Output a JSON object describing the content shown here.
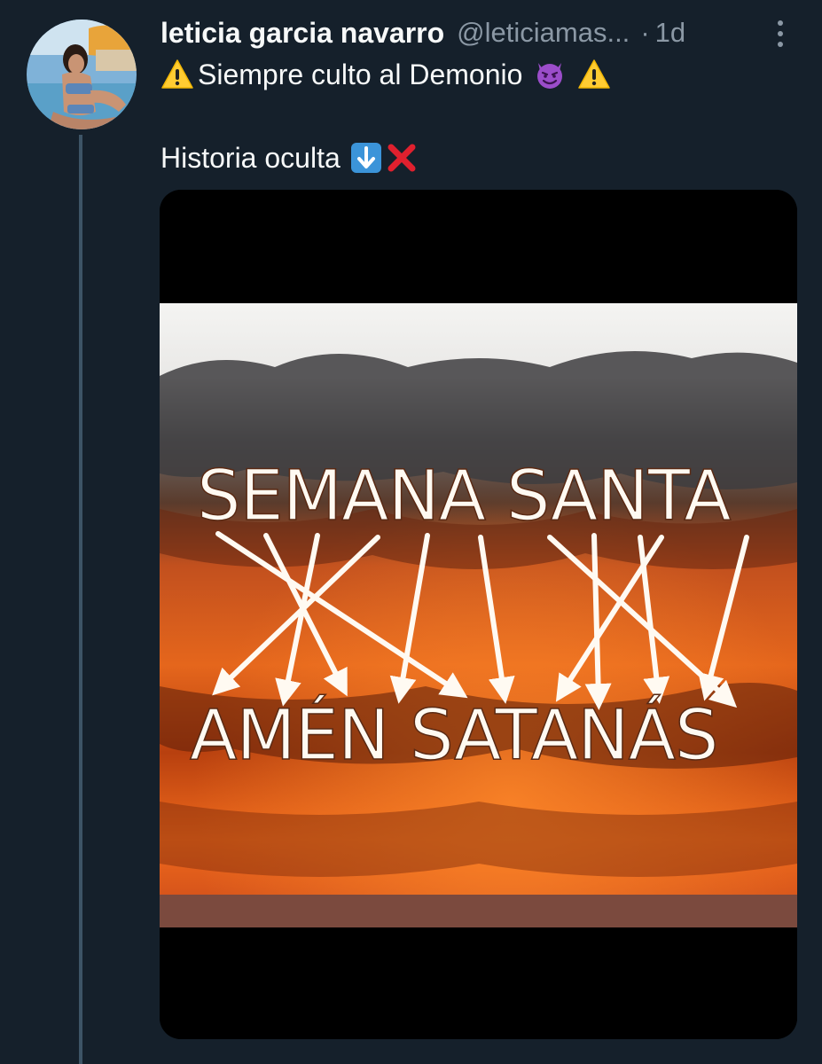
{
  "tweet": {
    "display_name": "leticia garcia navarro",
    "handle": "@leticiamas...",
    "separator": "·",
    "time": "1d",
    "line1": "Siempre culto al Demonio",
    "line2": "Historia oculta"
  },
  "media": {
    "top_text": "SEMANA SANTA",
    "bottom_text": "AMÉN SATANÁS"
  },
  "icons": {
    "warning": "warning-icon",
    "devil": "devil-face-icon",
    "down_arrow": "down-arrow-icon",
    "cross": "cross-mark-icon",
    "more": "more-icon"
  },
  "colors": {
    "background": "#15202b",
    "secondary_text": "#8b98a5",
    "thread_line": "#3d5466"
  }
}
